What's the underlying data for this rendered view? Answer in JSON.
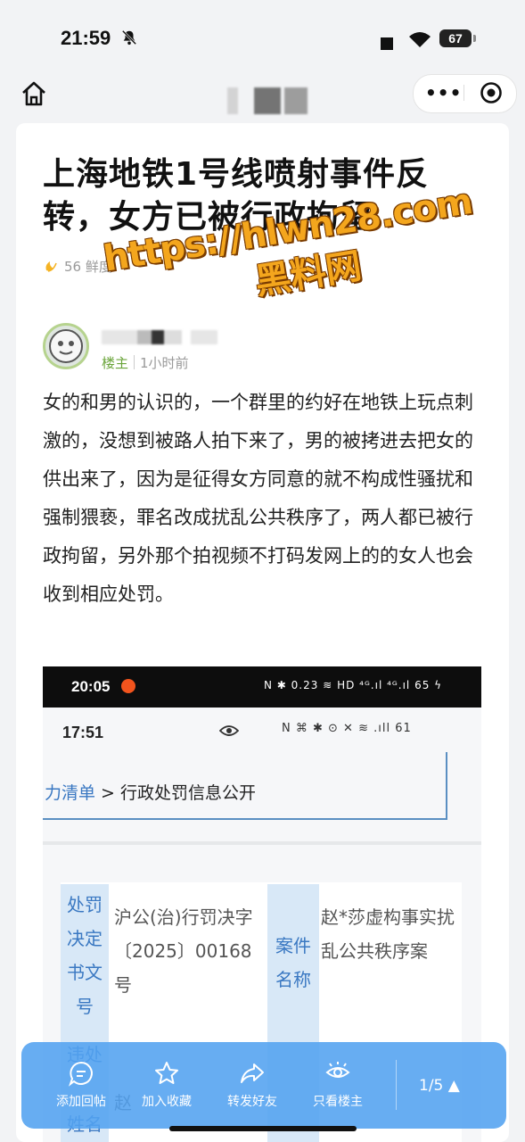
{
  "status_bar": {
    "time": "21:59",
    "battery": "67"
  },
  "nav": {
    "more_icon": "more-dots-icon",
    "target_icon": "target-icon"
  },
  "post": {
    "title": "上海地铁1号线喷射事件反转，女方已被行政拘留",
    "freshness": "56 鲜度",
    "role": "楼主",
    "time": "1小时前",
    "body": "女的和男的认识的，一个群里的约好在地铁上玩点刺激的，没想到被路人拍下来了，男的被拷进去把女的供出来了，因为是征得女方同意的就不构成性骚扰和强制猥亵，罪名改成扰乱公共秩序了，两人都已被行政拘留，另外那个拍视频不打码发网上的的女人也会收到相应处罚。"
  },
  "watermark": {
    "url": "https://hlwn28.com",
    "name": "黑料网"
  },
  "embedded": {
    "time_outer": "20:05",
    "icons_outer": "N ✱ 0.23 ≋ HD ⁴ᴳ.ıl ⁴ᴳ.ıl 65 ϟ",
    "time_inner": "17:51",
    "icons_inner": "N ⌘ ✱ ⊙ ✕ ≋ .ıll 61",
    "breadcrumb_prefix": "力清单",
    "breadcrumb_sep": " > ",
    "breadcrumb_current": "行政处罚信息公开",
    "h1": "处罚决定书文号",
    "v1": "沪公(治)行罚决字〔2025〕00168号",
    "h2": "案件名称",
    "v2": "赵*莎虚构事实扰乱公共秩序案",
    "h3_partial": "违处",
    "v3_partial": "赵",
    "h4_partial": "姓名"
  },
  "bottom_bar": {
    "items": [
      {
        "label": "添加回帖",
        "icon": "comment-icon"
      },
      {
        "label": "加入收藏",
        "icon": "star-icon"
      },
      {
        "label": "转发好友",
        "icon": "share-icon"
      },
      {
        "label": "只看楼主",
        "icon": "eye-icon"
      }
    ],
    "page": "1/5"
  }
}
